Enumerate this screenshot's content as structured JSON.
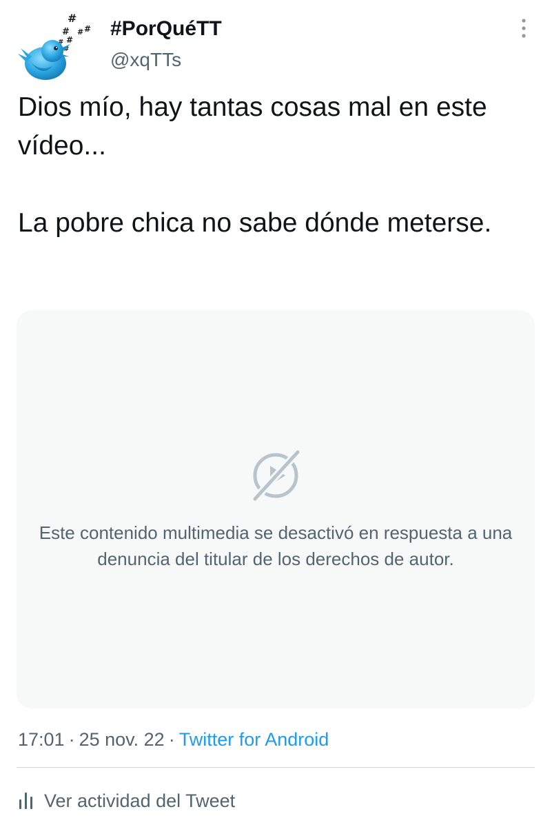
{
  "tweet": {
    "author": {
      "display_name": "#PorQuéTT",
      "handle": "@xqTTs",
      "avatar_icon": "bluebird-hashtags-avatar-icon"
    },
    "more_icon": "more-vertical-icon",
    "text_paragraphs": [
      "Dios mío, hay tantas cosas mal en este vídeo...",
      "La pobre chica no sabe dónde meterse."
    ],
    "media": {
      "icon": "media-disabled-icon",
      "message": "Este contenido multimedia se desactivó en respuesta a una denuncia del titular de los derechos de autor."
    },
    "meta": {
      "time": "17:01",
      "separator": "·",
      "date": "25 nov. 22",
      "source": "Twitter for Android"
    },
    "activity": {
      "icon": "analytics-icon",
      "label": "Ver actividad del Tweet"
    }
  },
  "colors": {
    "text_primary": "#0f1419",
    "text_secondary": "#536471",
    "link": "#1d9bf0",
    "media_bg": "#f7f9f9",
    "divider": "#cfd9de",
    "avatar_blue": "#29a9e1"
  }
}
